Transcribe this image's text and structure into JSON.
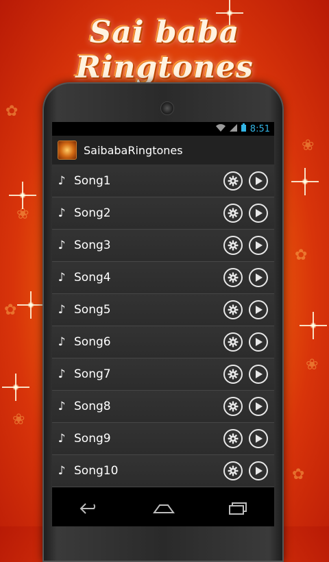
{
  "banner": {
    "title": "Sai baba Ringtones"
  },
  "status_bar": {
    "time": "8:51"
  },
  "app": {
    "title": "SaibabaRingtones"
  },
  "songs": [
    {
      "label": "Song1"
    },
    {
      "label": "Song2"
    },
    {
      "label": "Song3"
    },
    {
      "label": "Song4"
    },
    {
      "label": "Song5"
    },
    {
      "label": "Song6"
    },
    {
      "label": "Song7"
    },
    {
      "label": "Song8"
    },
    {
      "label": "Song9"
    },
    {
      "label": "Song10"
    }
  ],
  "icons": {
    "row_leading": "music-note-icon",
    "row_settings": "gear-icon",
    "row_play": "play-icon",
    "nav": [
      "back-icon",
      "home-icon",
      "recents-icon"
    ]
  },
  "colors": {
    "clock": "#33b5e5",
    "background_primary": "#f06a0c",
    "list_row": "#2e2e2e"
  }
}
